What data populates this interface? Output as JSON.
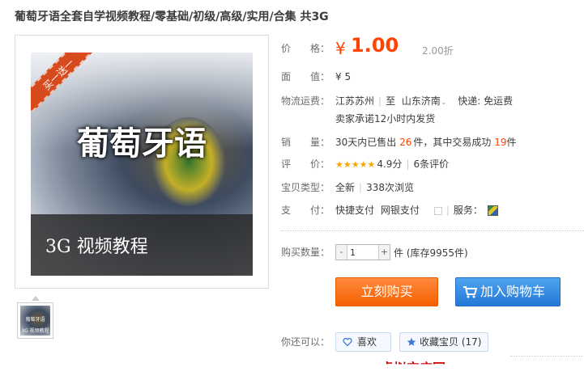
{
  "title": "葡萄牙语全套自学视频教程/零基础/初级/高级/实用/合集 共3G",
  "image": {
    "ribbon": "买一送一",
    "headline": "葡萄牙语",
    "band": "3G 视频教程"
  },
  "thumb": {
    "top": "葡萄牙语",
    "bottom": "3G 视频教程"
  },
  "info": {
    "price_label": "价　　格：",
    "price_symbol": "¥",
    "price": "1.00",
    "discount": "2.00折",
    "face_label": "面　　值：",
    "face_value": "¥ 5",
    "logistics_label": "物流运费：",
    "ship_from": "江苏苏州",
    "ship_to_prefix": "至",
    "ship_to": "山东济南",
    "ship_fee": "快递: 免运费",
    "ship_promise": "卖家承诺12小时内发货",
    "sales_label": "销　　量：",
    "sales_prefix": "30天内已售出",
    "sales_count": "26",
    "sales_mid": "件，其中交易成功",
    "sales_success": "19",
    "sales_suffix": "件",
    "rating_label": "评　　价：",
    "stars": "★★★★★",
    "rating": "4.9分",
    "reviews": "6条评价",
    "type_label": "宝贝类型：",
    "type_value": "全新",
    "views": "338次浏览",
    "pay_label": "支　　付：",
    "pay_1": "快捷支付",
    "pay_2": "网银支付",
    "service_label": "服务：",
    "qty_label": "购买数量：",
    "qty_value": "1",
    "qty_minus": "-",
    "qty_plus": "+",
    "stock": "件 (库存9955件)",
    "buy_now": "立刻购买",
    "add_cart": "加入购物车",
    "also_label": "你还可以：",
    "like": "喜欢",
    "favorite": "收藏宝贝 (17)",
    "bottom_text": "虚拟宝店网"
  },
  "colors": {
    "price": "#ff4400",
    "buy_button": "#f55f00",
    "cart_button": "#2577d6",
    "star": "#f7a600"
  },
  "icons": [
    "cart-icon",
    "heart-icon",
    "star-icon",
    "service-icon",
    "dropdown-arrow-icon"
  ]
}
